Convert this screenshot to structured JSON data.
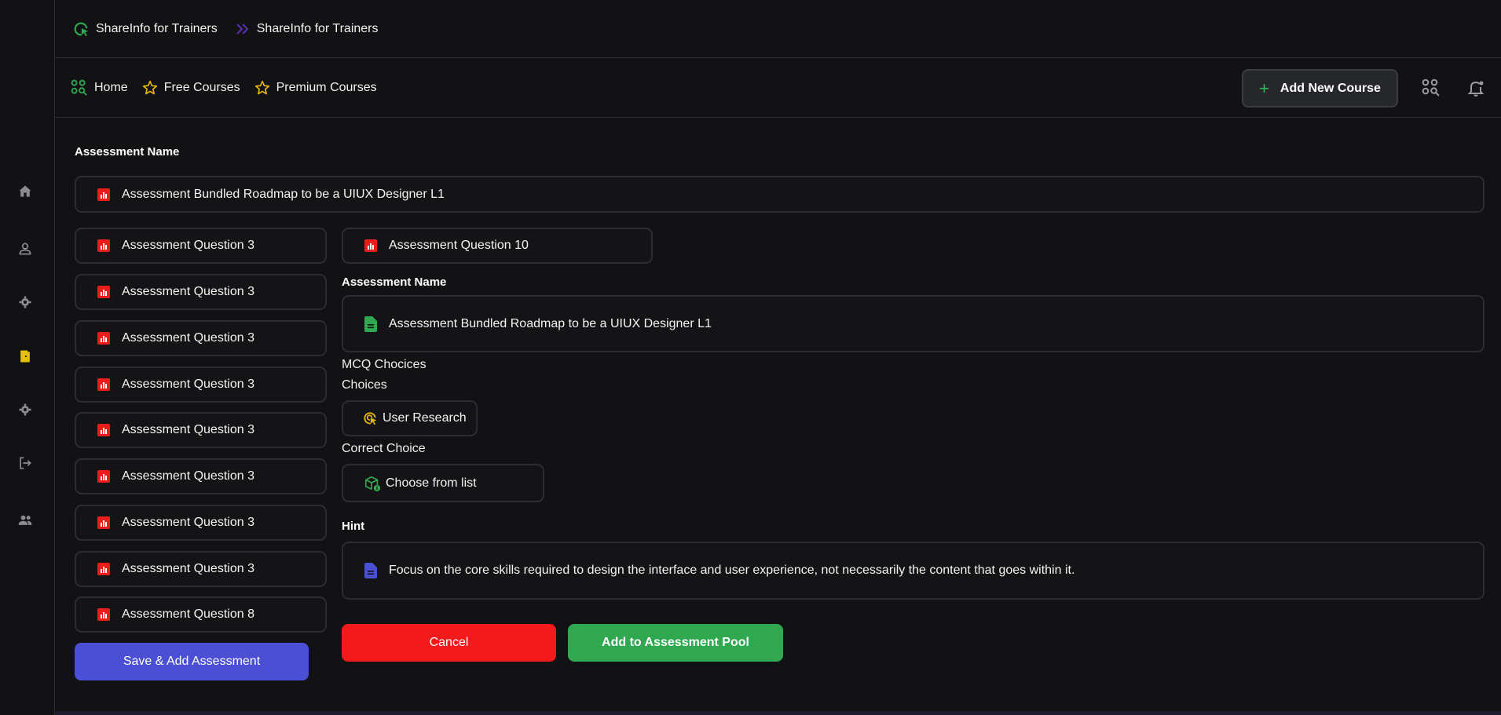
{
  "breadcrumb": [
    "ShareInfo for Trainers",
    "ShareInfo for Trainers"
  ],
  "nav": {
    "home": "Home",
    "free_courses": "Free Courses",
    "premium_courses": "Premium Courses",
    "add_course": "Add New Course"
  },
  "assessment": {
    "name_label": "Assessment Name",
    "name_value": "Assessment Bundled Roadmap to be a UIUX Designer L1",
    "questions": [
      "Assessment Question 3",
      "Assessment Question 3",
      "Assessment Question 3",
      "Assessment Question 3",
      "Assessment Question 3",
      "Assessment Question 3",
      "Assessment Question 3",
      "Assessment Question 3",
      "Assessment Question 8"
    ],
    "save_button": "Save & Add Assessment"
  },
  "editor": {
    "current_question": "Assessment Question 10",
    "name_label": "Assessment Name",
    "name_value": "Assessment Bundled Roadmap to be a UIUX Designer L1",
    "mcq_label": "MCQ Chocices",
    "choices_label": "Choices",
    "choice_1": "User Research",
    "correct_label": "Correct Choice",
    "correct_placeholder": "Choose from list",
    "hint_label": "Hint",
    "hint_value": "Focus on the core skills required to design the interface and user experience, not necessarily the content that goes within it.",
    "cancel_button": "Cancel",
    "add_pool_button": "Add to Assessment Pool"
  },
  "colors": {
    "accent_green": "#2fa84f",
    "danger_red": "#f21a1a",
    "primary_blue": "#4a4fd4",
    "star_yellow": "#e6b800"
  }
}
